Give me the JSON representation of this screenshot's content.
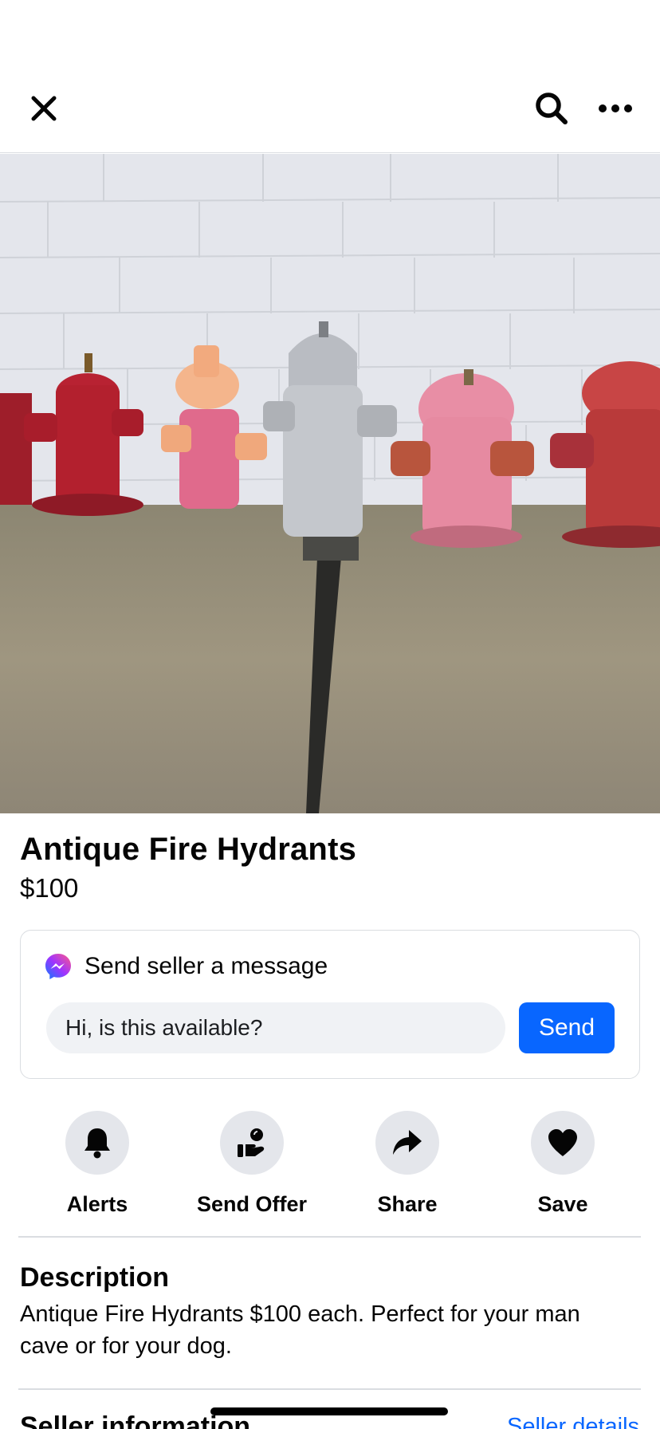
{
  "toolbar": {
    "close_icon": "close-icon",
    "search_icon": "search-icon",
    "more_icon": "more-icon"
  },
  "listing": {
    "title": "Antique Fire Hydrants",
    "price": "$100"
  },
  "message": {
    "heading": "Send seller a message",
    "input_value": "Hi, is this available?",
    "send_label": "Send",
    "accent": "#0866ff"
  },
  "actions": [
    {
      "label": "Alerts",
      "icon": "bell-icon"
    },
    {
      "label": "Send Offer",
      "icon": "offer-icon"
    },
    {
      "label": "Share",
      "icon": "share-icon"
    },
    {
      "label": "Save",
      "icon": "heart-icon"
    }
  ],
  "description": {
    "heading": "Description",
    "body": "Antique Fire Hydrants  $100 each. Perfect for your man cave or for your dog."
  },
  "seller": {
    "heading": "Seller information",
    "details_link": "Seller details"
  }
}
